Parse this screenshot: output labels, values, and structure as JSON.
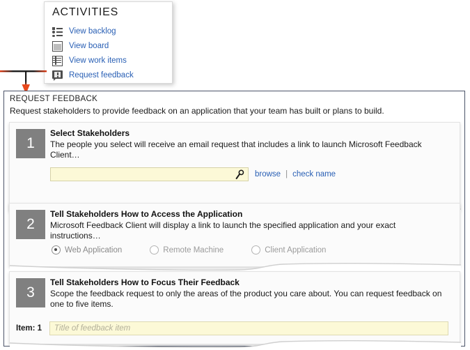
{
  "activities_menu": {
    "title": "ACTIVITIES",
    "items": [
      {
        "label": "View backlog",
        "icon": "backlog-list-icon"
      },
      {
        "label": "View board",
        "icon": "board-icon"
      },
      {
        "label": "View work items",
        "icon": "work-items-grid-icon"
      },
      {
        "label": "Request feedback",
        "icon": "feedback-callout-icon"
      }
    ]
  },
  "callout": {
    "arrow_color": "#e03a12",
    "arrow_stem_color": "#1c1c1c"
  },
  "panel": {
    "title": "REQUEST FEEDBACK",
    "subtitle": "Request stakeholders to provide feedback on an application that your team has built or plans to build.",
    "border_color": "#4b5368"
  },
  "steps": [
    {
      "number": "1",
      "title": "Select Stakeholders",
      "description": "The people you select will receive an email request that includes a link to launch Microsoft Feedback Client…",
      "field": {
        "value": "",
        "placeholder": "",
        "icon": "search-magnifier-icon"
      },
      "links": [
        {
          "label": "browse"
        },
        {
          "label": "check name"
        }
      ],
      "link_separator": "|"
    },
    {
      "number": "2",
      "title": "Tell Stakeholders How to Access the Application",
      "description": "Microsoft Feedback Client will display a link to launch the specified application and your exact instructions…",
      "radio_options": [
        {
          "label": "Web Application",
          "selected": true
        },
        {
          "label": "Remote Machine",
          "selected": false
        },
        {
          "label": "Client Application",
          "selected": false
        }
      ]
    },
    {
      "number": "3",
      "title": "Tell Stakeholders How to Focus Their Feedback",
      "description": "Scope the feedback request to only the areas of the product you care about. You can request feedback on one to five items.",
      "item_label": "Item: 1",
      "item_field": {
        "value": "",
        "placeholder": "Title of feedback item"
      }
    }
  ],
  "colors": {
    "badge_gray": "#808080",
    "link_blue": "#2a60b5",
    "field_yellow": "#fcf9d7",
    "card_bg": "#fbfbfb"
  }
}
